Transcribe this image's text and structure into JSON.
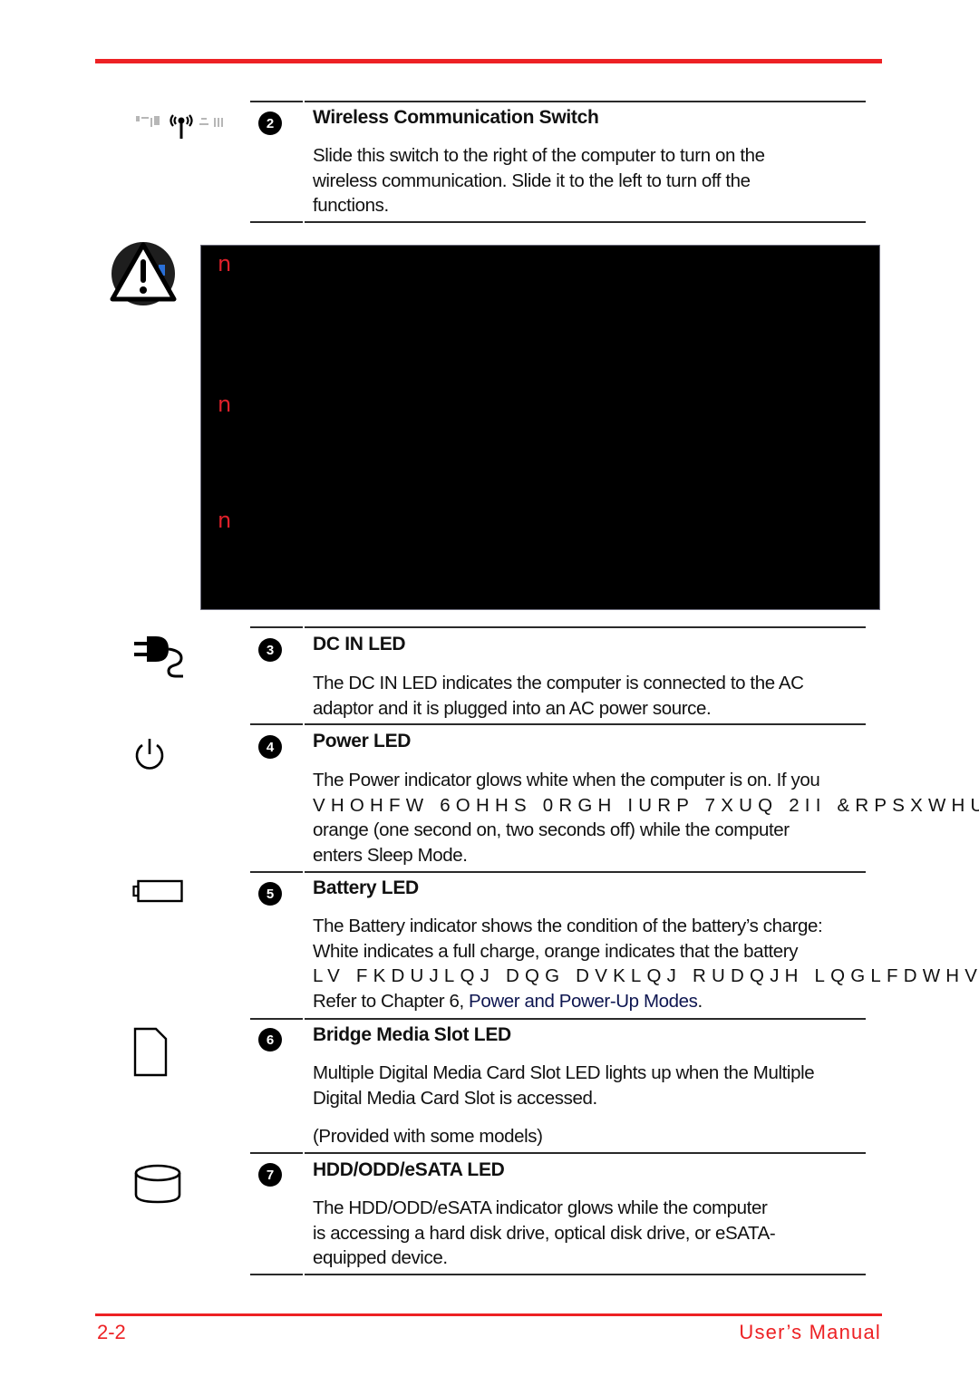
{
  "header": {
    "accent_color": "#ed2124"
  },
  "items": [
    {
      "number": "2",
      "icon": "wireless-antenna-icon",
      "title": "Wireless Communication Switch",
      "lines": [
        "Slide this switch to the right of the computer to turn on the",
        "wireless communication. Slide it to the left to turn off the",
        "functions."
      ]
    },
    {
      "number": "3",
      "icon": "dc-in-plug-icon",
      "title": "DC IN LED",
      "lines": [
        "The DC IN LED indicates the computer is connected to the AC",
        "adaptor and it is plugged into an AC power source."
      ]
    },
    {
      "number": "4",
      "icon": "power-icon",
      "title": "Power LED",
      "lines": [
        "The Power indicator glows white when the computer is on. If you",
        "VHOHFW 6OHHS 0RGH IURP 7XUQ 2II &RPSXWHU",
        "orange (one second on, two seconds off) while the computer",
        "enters Sleep Mode."
      ]
    },
    {
      "number": "5",
      "icon": "battery-icon",
      "title": "Battery LED",
      "lines": [
        "The Battery indicator shows the condition of the battery’s charge:",
        "White indicates a full charge, orange indicates that the battery",
        "LV FKDUJLQJ DQG  DVKLQJ RUDQJH LQGLFDWHV"
      ],
      "ref_prefix": "Refer to Chapter 6, ",
      "ref_link": "Power and Power-Up Modes",
      "ref_suffix": "."
    },
    {
      "number": "6",
      "icon": "media-card-icon",
      "title": "Bridge Media Slot LED",
      "lines": [
        "Multiple Digital Media Card Slot LED lights up when the Multiple",
        "Digital Media Card Slot is accessed."
      ],
      "note": "(Provided with some models)"
    },
    {
      "number": "7",
      "icon": "hard-disk-icon",
      "title": "HDD/ODD/eSATA LED",
      "lines": [
        "The HDD/ODD/eSATA indicator glows while the computer",
        "is accessing a hard disk drive, optical disk drive, or eSATA-",
        "equipped device."
      ]
    }
  ],
  "warning": {
    "icon": "warning-icon",
    "bullets": [
      "n",
      "n",
      "n"
    ]
  },
  "footer": {
    "page_number": "2-2",
    "manual_title": "User’s Manual"
  }
}
